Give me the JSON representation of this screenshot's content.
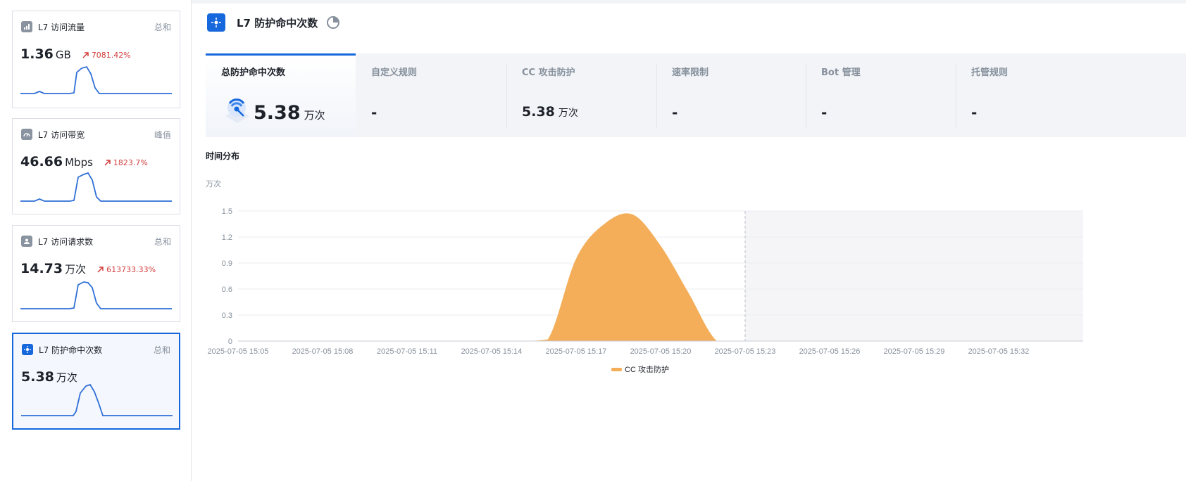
{
  "sidebar": {
    "cards": [
      {
        "title": "L7 访问流量",
        "agg": "总和",
        "value": "1.36",
        "unit": "GB",
        "trend": "7081.42%",
        "icon": "bar-chart-icon"
      },
      {
        "title": "L7 访问带宽",
        "agg": "峰值",
        "value": "46.66",
        "unit": "Mbps",
        "trend": "1823.7%",
        "icon": "gauge-icon"
      },
      {
        "title": "L7 访问请求数",
        "agg": "总和",
        "value": "14.73",
        "unit": "万次",
        "trend": "613733.33%",
        "icon": "user-icon"
      },
      {
        "title": "L7 防护命中次数",
        "agg": "总和",
        "value": "5.38",
        "unit": "万次",
        "trend": "",
        "icon": "shield-target-icon"
      }
    ]
  },
  "main": {
    "title": "L7 防护命中次数",
    "tabs": [
      {
        "label": "总防护命中次数",
        "value": "5.38",
        "unit": "万次"
      },
      {
        "label": "自定义规则",
        "value": "-",
        "unit": ""
      },
      {
        "label": "CC 攻击防护",
        "value": "5.38",
        "unit": "万次"
      },
      {
        "label": "速率限制",
        "value": "-",
        "unit": ""
      },
      {
        "label": "Bot 管理",
        "value": "-",
        "unit": ""
      },
      {
        "label": "托管规则",
        "value": "-",
        "unit": ""
      }
    ],
    "section_title": "时间分布",
    "unit_label": "万次"
  },
  "colors": {
    "accent": "#1668dc",
    "series": "#f4ae5a",
    "trend_up": "#d23c3c"
  },
  "chart_data": {
    "type": "area",
    "ylabel": "万次",
    "ylim": [
      0,
      1.5
    ],
    "yticks": [
      "0",
      "0.3",
      "0.6",
      "0.9",
      "1.2",
      "1.5"
    ],
    "xticks": [
      "2025-07-05 15:05",
      "2025-07-05 15:08",
      "2025-07-05 15:11",
      "2025-07-05 15:14",
      "2025-07-05 15:17",
      "2025-07-05 15:20",
      "2025-07-05 15:23",
      "2025-07-05 15:26",
      "2025-07-05 15:29",
      "2025-07-05 15:32"
    ],
    "grid": true,
    "legend_position": "bottom",
    "series": [
      {
        "name": "CC 攻击防护",
        "x": [
          "15:05",
          "15:06",
          "15:07",
          "15:08",
          "15:09",
          "15:10",
          "15:11",
          "15:12",
          "15:13",
          "15:14",
          "15:15",
          "15:16",
          "15:17",
          "15:18",
          "15:19",
          "15:20",
          "15:21",
          "15:22",
          "15:23"
        ],
        "values": [
          0,
          0,
          0,
          0,
          0,
          0,
          0,
          0,
          0,
          0,
          0,
          0.02,
          0.95,
          1.35,
          1.46,
          1.1,
          0.55,
          0,
          0
        ]
      }
    ],
    "marker_line_at": "2025-07-05 15:23"
  }
}
